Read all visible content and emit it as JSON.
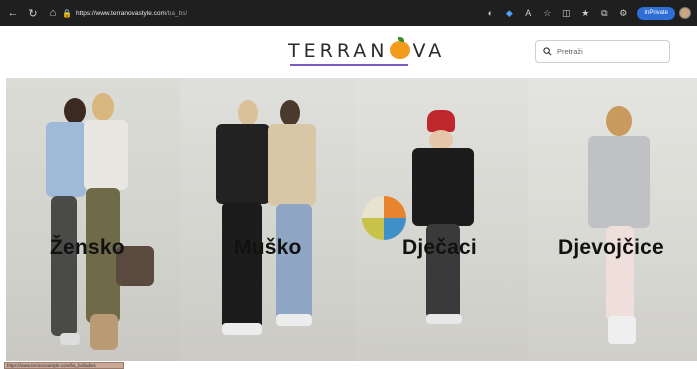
{
  "browser": {
    "url_domain": "https://www.terranovastyle.com",
    "url_path": "/ba_bs/",
    "inprivate_label": "InPrivate",
    "status_url": "https://www.terranovastyle.com/ba_bs/ladies"
  },
  "site": {
    "logo_text_left": "TERRAN",
    "logo_text_right": "VA",
    "search_placeholder": "Pretraži",
    "brand_color": "#7a5cc4",
    "logo_orange": "#f29b1f"
  },
  "categories": [
    {
      "label": "Žensko"
    },
    {
      "label": "Muško"
    },
    {
      "label": "Dječaci"
    },
    {
      "label": "Djevojčice"
    }
  ]
}
